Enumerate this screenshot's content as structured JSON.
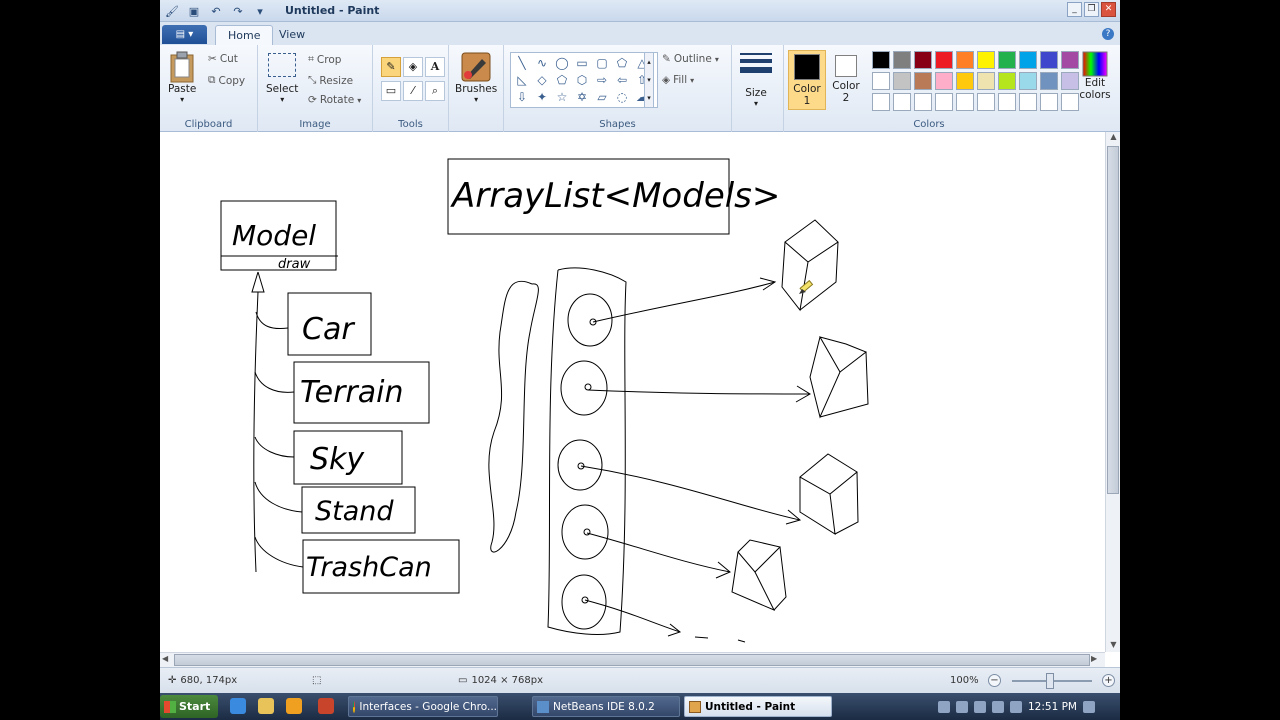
{
  "window": {
    "title": "Untitled - Paint",
    "quick_access": [
      "save-icon",
      "undo-icon",
      "redo-icon",
      "customize-icon"
    ],
    "controls": [
      "_",
      "❐",
      "✕"
    ]
  },
  "tabs": [
    {
      "label": "Home",
      "active": true
    },
    {
      "label": "View",
      "active": false
    }
  ],
  "ribbon": {
    "clipboard": {
      "paste": "Paste",
      "cut": "Cut",
      "copy": "Copy",
      "group": "Clipboard"
    },
    "image": {
      "select": "Select",
      "crop": "Crop",
      "resize": "Resize",
      "rotate": "Rotate",
      "group": "Image"
    },
    "tools": {
      "group": "Tools",
      "items": [
        "pencil-icon",
        "fill-icon",
        "text-icon",
        "eraser-icon",
        "color-picker-icon",
        "magnifier-icon"
      ]
    },
    "brushes": {
      "label": "Brushes"
    },
    "shapes": {
      "group": "Shapes",
      "outline": "Outline",
      "fill": "Fill"
    },
    "size": {
      "label": "Size"
    },
    "colors": {
      "group": "Colors",
      "color1": {
        "label": "Color",
        "num": "1",
        "value": "#000000"
      },
      "color2": {
        "label": "Color",
        "num": "2",
        "value": "#ffffff"
      },
      "edit": "Edit colors",
      "palette": [
        "#000000",
        "#7f7f7f",
        "#880015",
        "#ed1c24",
        "#ff7f27",
        "#fff200",
        "#22b14c",
        "#00a2e8",
        "#3f48cc",
        "#a349a4",
        "#ffffff",
        "#c3c3c3",
        "#b97a57",
        "#ffaec9",
        "#ffc90e",
        "#efe4b0",
        "#b5e61d",
        "#99d9ea",
        "#7092be",
        "#c8bfe7",
        "#ffffff",
        "#ffffff",
        "#ffffff",
        "#ffffff",
        "#ffffff",
        "#ffffff",
        "#ffffff",
        "#ffffff",
        "#ffffff",
        "#ffffff"
      ]
    }
  },
  "drawing": {
    "title_box": "ArrayList<Models>",
    "model_class": "Model",
    "model_method": "draw",
    "subclasses": [
      "Car",
      "Terrain",
      "Sky",
      "Stand",
      "TrashCan"
    ]
  },
  "status": {
    "cursor": "680, 174px",
    "size": "1024 × 768px",
    "zoom": "100%"
  },
  "taskbar": {
    "start": "Start",
    "tasks": [
      {
        "label": "Interfaces - Google Chro...",
        "active": false
      },
      {
        "label": "NetBeans IDE 8.0.2",
        "active": false
      },
      {
        "label": "Untitled - Paint",
        "active": true
      }
    ],
    "clock": "12:51 PM"
  }
}
